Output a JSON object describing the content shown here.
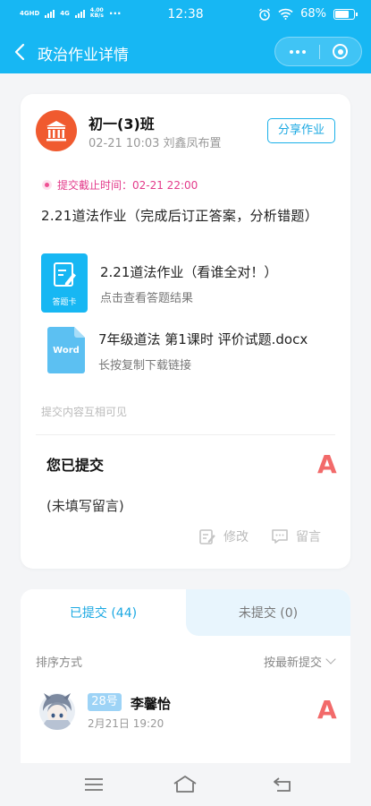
{
  "status_bar": {
    "net1": "4GHD",
    "net2": "4G",
    "speed": "4.00\nKB/s",
    "dots": "···",
    "time": "12:38",
    "battery": "68%"
  },
  "header": {
    "title": "政治作业详情"
  },
  "homework": {
    "class_name": "初一(3)班",
    "meta": "02-21 10:03 刘鑫凤布置",
    "share_label": "分享作业",
    "deadline": "提交截止时间：02-21 22:00",
    "description": "2.21道法作业（完成后订正答案，分析错题）",
    "answer_card": {
      "icon_label": "答题卡",
      "title": "2.21道法作业（看谁全对！）",
      "subtitle": "点击查看答题结果"
    },
    "attachment": {
      "icon_label": "Word",
      "title": "7年级道法 第1课时 评价试题.docx",
      "subtitle": "长按复制下载链接"
    },
    "visibility_note": "提交内容互相可见"
  },
  "my_submission": {
    "title": "您已提交",
    "grade": "A",
    "comment": "(未填写留言)",
    "edit_label": "修改",
    "message_label": "留言"
  },
  "submissions": {
    "tab_submitted": "已提交 (44)",
    "tab_unsubmitted": "未提交 (0)",
    "sort_label": "排序方式",
    "sort_value": "按最新提交",
    "items": [
      {
        "number": "28号",
        "name": "李馨怡",
        "time": "2月21日 19:20",
        "grade": "A"
      }
    ]
  }
}
